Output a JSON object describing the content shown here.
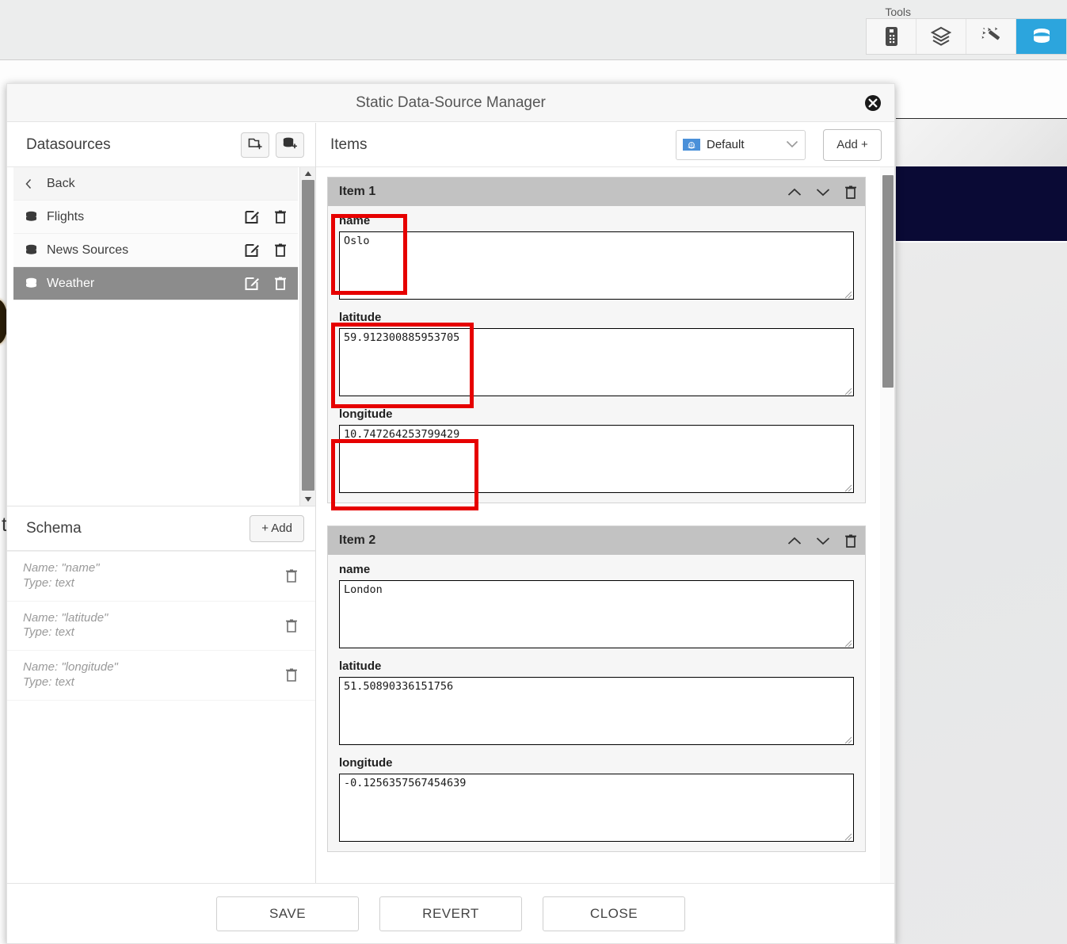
{
  "toolbar": {
    "label": "Tools",
    "buttons": [
      {
        "name": "widget-tool",
        "icon": "remote-control-icon",
        "active": false
      },
      {
        "name": "layers-tool",
        "icon": "layers-icon",
        "active": false
      },
      {
        "name": "style-tool",
        "icon": "magic-wand-icon",
        "active": false
      },
      {
        "name": "datasource-tool",
        "icon": "database-icon",
        "active": true
      }
    ],
    "active_color": "#2ca5dd"
  },
  "dialog": {
    "title": "Static Data-Source Manager",
    "close_icon": "close-icon"
  },
  "datasources": {
    "title": "Datasources",
    "add_folder_icon": "add-folder-icon",
    "add_datasource_icon": "add-database-icon",
    "back_label": "Back",
    "items": [
      {
        "label": "Flights",
        "selected": false
      },
      {
        "label": "News Sources",
        "selected": false
      },
      {
        "label": "Weather",
        "selected": true
      }
    ],
    "row_edit_icon": "edit-icon",
    "row_delete_icon": "trash-icon",
    "selected_color": "#8c8c8c"
  },
  "schema": {
    "title": "Schema",
    "add_label": "+ Add",
    "fields": [
      {
        "name_line": "Name: \"name\"",
        "type_line": "Type: text"
      },
      {
        "name_line": "Name: \"latitude\"",
        "type_line": "Type: text"
      },
      {
        "name_line": "Name: \"longitude\"",
        "type_line": "Type: text"
      }
    ],
    "delete_icon": "trash-icon"
  },
  "items_panel": {
    "title": "Items",
    "locale": {
      "label": "Default",
      "flag_icon": "un-flag-icon",
      "chevron_icon": "chevron-down-icon"
    },
    "add_label": "Add +",
    "move_up_icon": "chevron-up-icon",
    "move_down_icon": "chevron-down-icon",
    "delete_icon": "trash-icon",
    "items": [
      {
        "title": "Item 1",
        "fields": [
          {
            "label": "name",
            "value": "Oslo",
            "annotated": true
          },
          {
            "label": "latitude",
            "value": "59.912300885953705",
            "annotated": true
          },
          {
            "label": "longitude",
            "value": "10.747264253799429",
            "annotated": true
          }
        ]
      },
      {
        "title": "Item 2",
        "fields": [
          {
            "label": "name",
            "value": "London",
            "annotated": false
          },
          {
            "label": "latitude",
            "value": "51.50890336151756",
            "annotated": false
          },
          {
            "label": "longitude",
            "value": "-0.1256357567454639",
            "annotated": false
          }
        ]
      }
    ]
  },
  "footer": {
    "save_label": "SAVE",
    "revert_label": "REVERT",
    "close_label": "CLOSE"
  },
  "annotation": {
    "color": "#e60000"
  }
}
